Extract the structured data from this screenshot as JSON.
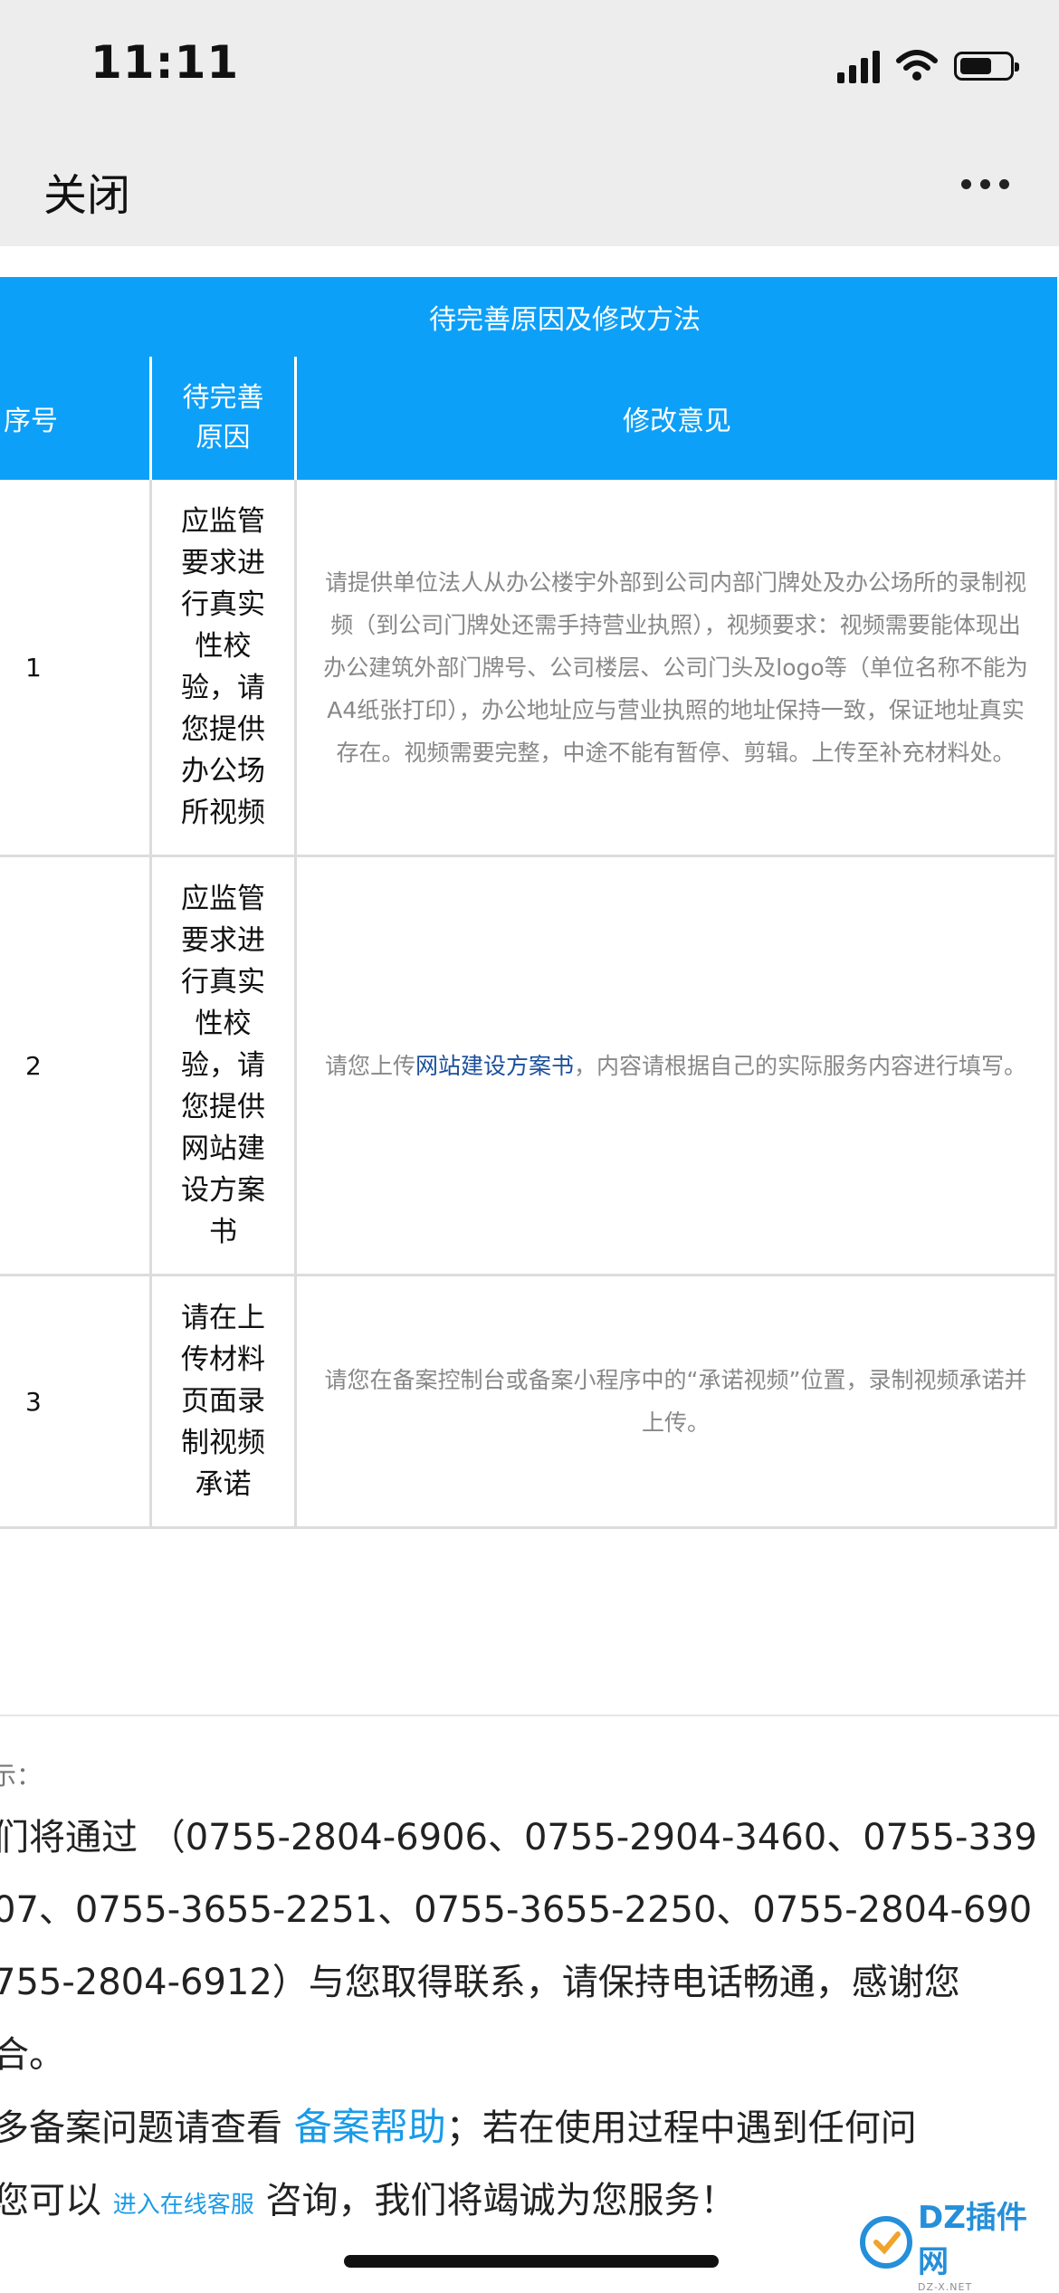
{
  "status_bar": {
    "time": "11:11"
  },
  "nav": {
    "close_label": "关闭"
  },
  "table": {
    "title": "待完善原因及修改方法",
    "headers": {
      "index": "序号",
      "reason": "待完善原因",
      "advice": "修改意见"
    },
    "rows": [
      {
        "index": "1",
        "reason": "应监管要求进行真实性校验，请您提供办公场所视频",
        "advice": "请提供单位法人从办公楼宇外部到公司内部门牌处及办公场所的录制视频（到公司门牌处还需手持营业执照），视频要求：视频需要能体现出办公建筑外部门牌号、公司楼层、公司门头及logo等（单位名称不能为A4纸张打印），办公地址应与营业执照的地址保持一致，保证地址真实存在。视频需要完整，中途不能有暂停、剪辑。上传至补充材料处。"
      },
      {
        "index": "2",
        "reason": "应监管要求进行真实性校验，请您提供网站建设方案书",
        "advice_prefix": "请您上传",
        "advice_link": "网站建设方案书",
        "advice_suffix": "，内容请根据自己的实际服务内容进行填写。"
      },
      {
        "index": "3",
        "reason": "请在上传材料页面录制视频承诺",
        "advice": "请您在备案控制台或备案小程序中的“承诺视频”位置，录制视频承诺并上传。"
      }
    ]
  },
  "notice": {
    "label": "示：",
    "line1": "们将通过 （0755-2804-6906、0755-2904-3460、0755-339",
    "line2": "07、0755-3655-2251、0755-3655-2250、0755-2804-690",
    "line3": "755-2804-6912）与您取得联系，请保持电话畅通，感谢您",
    "line4": "合。",
    "line5_prefix": "多备案问题请查看 ",
    "help_link": "备案帮助",
    "line5_suffix": "；若在使用过程中遇到任何问",
    "line6_prefix": "您可以 ",
    "service_link": "进入在线客服",
    "line6_suffix": " 咨询，我们将竭诚为您服务！"
  },
  "watermark": {
    "main": "DZ插件网",
    "sub": "DZ-X.NET"
  },
  "colors": {
    "header_blue": "#0da0f8",
    "link_blue": "#1a9be8",
    "dark_link": "#1a4f9c"
  }
}
